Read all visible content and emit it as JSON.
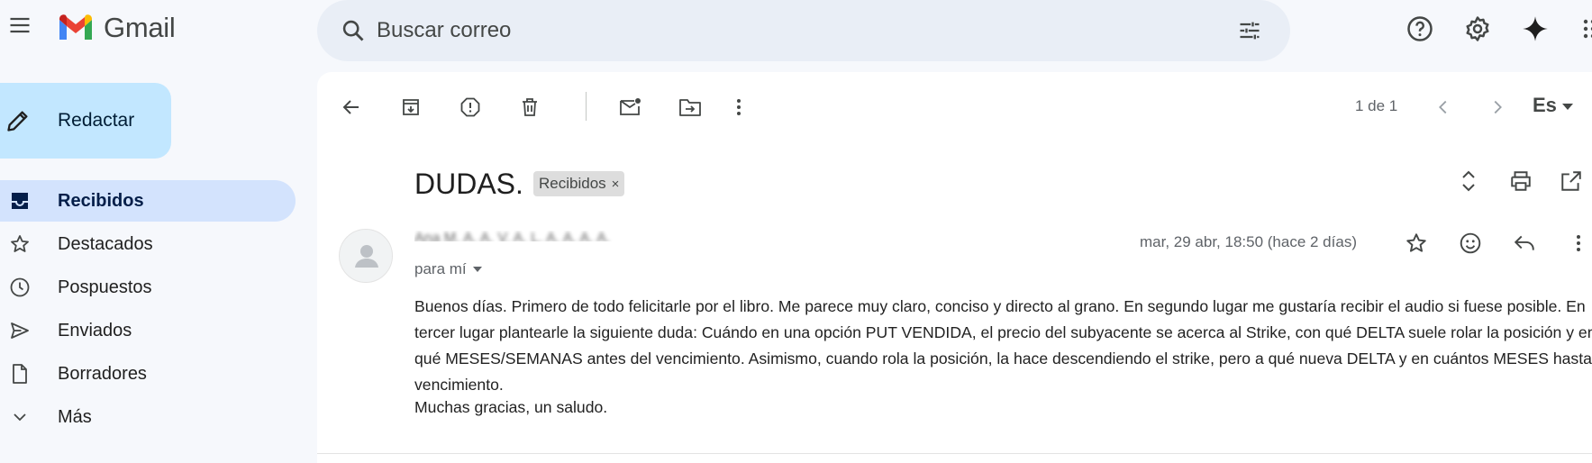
{
  "app": {
    "name": "Gmail"
  },
  "search": {
    "placeholder": "Buscar correo"
  },
  "sidebar": {
    "compose_label": "Redactar",
    "items": [
      {
        "label": "Recibidos",
        "icon": "inbox-icon",
        "active": true
      },
      {
        "label": "Destacados",
        "icon": "star-icon"
      },
      {
        "label": "Pospuestos",
        "icon": "clock-icon"
      },
      {
        "label": "Enviados",
        "icon": "send-icon"
      },
      {
        "label": "Borradores",
        "icon": "draft-icon"
      },
      {
        "label": "Más",
        "icon": "chevron-down-icon"
      }
    ]
  },
  "toolbar": {
    "pager": "1 de 1",
    "language": "Es"
  },
  "email": {
    "subject": "DUDAS.",
    "label": "Recibidos",
    "label_remove": "×",
    "sender_redacted": "Ana M. A. A. V. A. L. A. A. A. A.",
    "date": "mar, 29 abr, 18:50 (hace 2 días)",
    "recipient": "para mí",
    "body": "Buenos días. Primero de todo felicitarle por el libro. Me parece muy claro, conciso y directo al grano. En segundo lugar me gustaría recibir el audio si fuese posible. En tercer lugar plantearle la siguiente duda: Cuándo en una opción PUT VENDIDA, el precio del subyacente se acerca al Strike, con qué DELTA suele rolar la posición y en qué MESES/SEMANAS antes del vencimiento. Asimismo, cuando rola la posición, la hace descendiendo el strike, pero a qué nueva DELTA y en cuántos MESES hasta vencimiento.",
    "closing": "Muchas gracias, un saludo."
  },
  "colors": {
    "background": "#f6f8fc",
    "compose": "#c2e7ff",
    "active_nav": "#d3e3fd",
    "search_bg": "#e9eef6"
  }
}
